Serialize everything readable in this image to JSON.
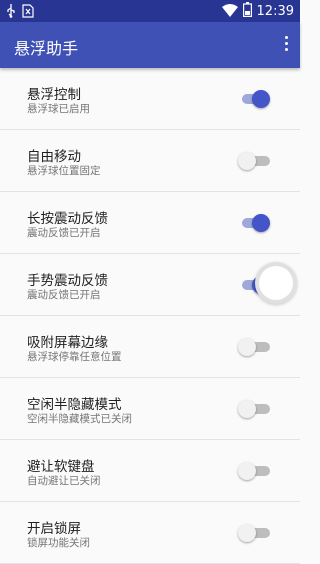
{
  "status_bar": {
    "time": "12:39",
    "left_icons": [
      "usb-icon",
      "sim-no-signal-icon"
    ],
    "right_icons": [
      "wifi-icon",
      "battery-icon"
    ]
  },
  "app_bar": {
    "title": "悬浮助手",
    "overflow_icon": "more-vert-icon"
  },
  "settings": [
    {
      "title": "悬浮控制",
      "subtitle": "悬浮球已启用",
      "enabled": true
    },
    {
      "title": "自由移动",
      "subtitle": "悬浮球位置固定",
      "enabled": false
    },
    {
      "title": "长按震动反馈",
      "subtitle": "震动反馈已开启",
      "enabled": true
    },
    {
      "title": "手势震动反馈",
      "subtitle": "震动反馈已开启",
      "enabled": true
    },
    {
      "title": "吸附屏幕边缘",
      "subtitle": "悬浮球停靠任意位置",
      "enabled": false
    },
    {
      "title": "空闲半隐藏模式",
      "subtitle": "空闲半隐藏模式已关闭",
      "enabled": false
    },
    {
      "title": "避让软键盘",
      "subtitle": "自动避让已关闭",
      "enabled": false
    },
    {
      "title": "开启锁屏",
      "subtitle": "锁屏功能关闭",
      "enabled": false
    }
  ],
  "colors": {
    "status_bar": "#283593",
    "app_bar": "#3f51b5",
    "switch_on": "#4355c8"
  }
}
